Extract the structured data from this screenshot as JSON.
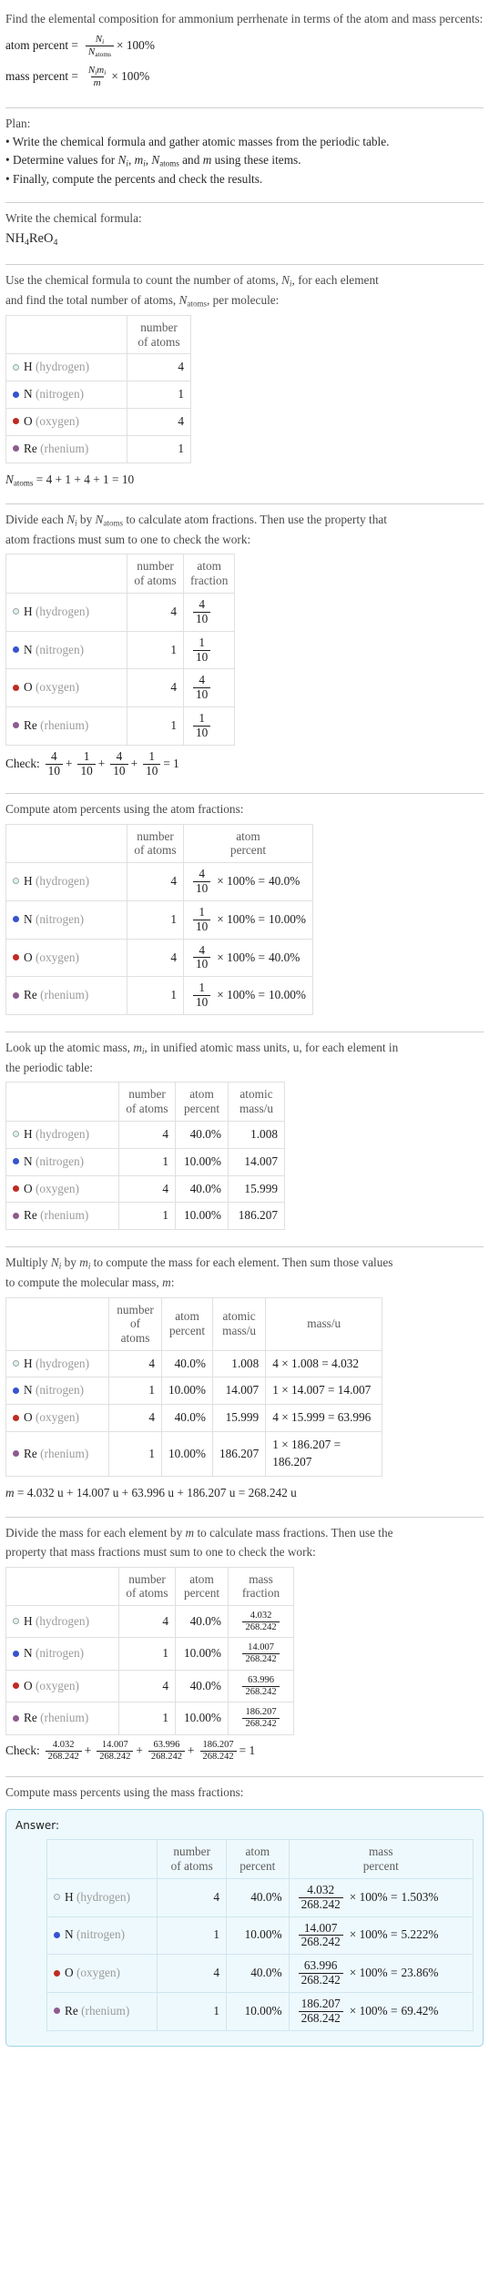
{
  "problem": {
    "statement": "Find the elemental composition for ammonium perrhenate in terms of the atom and mass percents:",
    "formula_atom_percent_label": "atom percent =",
    "formula_mass_percent_label": "mass percent =",
    "atom_percent_num": "N",
    "atom_percent_num_sub": "i",
    "atom_percent_den": "N",
    "atom_percent_den_sub": "atoms",
    "mass_percent_num": "N",
    "mass_percent_num_sub": "i",
    "mass_percent_num2": "m",
    "mass_percent_num2_sub": "i",
    "mass_percent_den": "m",
    "times_100": "× 100%"
  },
  "plan": {
    "heading": "Plan:",
    "bullets": [
      "• Write the chemical formula and gather atomic masses from the periodic table.",
      "• Determine values for Ni, mi, Natoms and m using these items.",
      "• Finally, compute the percents and check the results."
    ]
  },
  "chemical_formula": {
    "prompt": "Write the chemical formula:",
    "formula": "NH4ReO4",
    "formula_parts": [
      {
        "t": "NH",
        "sub": "4"
      },
      {
        "t": "ReO",
        "sub": "4"
      }
    ]
  },
  "count_atoms": {
    "prompt_line1": "Use the chemical formula to count the number of atoms, Ni, for each element",
    "prompt_line2": "and find the total number of atoms, Natoms, per molecule:",
    "headers": [
      "",
      "number of atoms"
    ],
    "total_equation": "Natoms = 4 + 1 + 4 + 1 = 10",
    "total_terms": [
      "4",
      "1",
      "4",
      "1"
    ],
    "total_value": "10"
  },
  "elements": [
    {
      "symbol": "H",
      "name": "(hydrogen)",
      "color": "#ddf2f2",
      "stroke": "#9aa5a5",
      "count": "4",
      "atom_fraction_num": "4",
      "atom_fraction_den": "10",
      "atom_percent": "40.0%",
      "atomic_mass": "1.008",
      "mass_expr_left": "4",
      "mass_expr_value": "4.032",
      "mass_fraction_num": "4.032",
      "mass_fraction_den": "268.242",
      "mass_percent": "1.503%"
    },
    {
      "symbol": "N",
      "name": "(nitrogen)",
      "color": "#3753cf",
      "stroke": "#3753cf",
      "count": "1",
      "atom_fraction_num": "1",
      "atom_fraction_den": "10",
      "atom_percent": "10.00%",
      "atomic_mass": "14.007",
      "mass_expr_left": "1",
      "mass_expr_value": "14.007",
      "mass_fraction_num": "14.007",
      "mass_fraction_den": "268.242",
      "mass_percent": "5.222%"
    },
    {
      "symbol": "O",
      "name": "(oxygen)",
      "color": "#c02b22",
      "stroke": "#c02b22",
      "count": "4",
      "atom_fraction_num": "4",
      "atom_fraction_den": "10",
      "atom_percent": "40.0%",
      "atomic_mass": "15.999",
      "mass_expr_left": "4",
      "mass_expr_value": "63.996",
      "mass_fraction_num": "63.996",
      "mass_fraction_den": "268.242",
      "mass_percent": "23.86%"
    },
    {
      "symbol": "Re",
      "name": "(rhenium)",
      "color": "#8e5c8e",
      "stroke": "#8e5c8e",
      "count": "1",
      "atom_fraction_num": "1",
      "atom_fraction_den": "10",
      "atom_percent": "10.00%",
      "atomic_mass": "186.207",
      "mass_expr_left": "1",
      "mass_expr_value": "186.207",
      "mass_fraction_num": "186.207",
      "mass_fraction_den": "268.242",
      "mass_percent": "69.42%"
    }
  ],
  "atom_fraction_section": {
    "prompt_line1": "Divide each Ni by Natoms to calculate atom fractions. Then use the property that",
    "prompt_line2": "atom fractions must sum to one to check the work:",
    "headers": [
      "",
      "number of atoms",
      "atom fraction"
    ],
    "check_label": "Check:",
    "check_result": "= 1"
  },
  "atom_percent_section": {
    "prompt": "Compute atom percents using the atom fractions:",
    "headers": [
      "",
      "number of atoms",
      "atom percent"
    ],
    "times_100_eq": "× 100% ="
  },
  "atomic_mass_section": {
    "prompt_line1": "Look up the atomic mass, mi, in unified atomic mass units, u, for each element in",
    "prompt_line2": "the periodic table:",
    "headers": [
      "",
      "number of atoms",
      "atom percent",
      "atomic mass/u"
    ]
  },
  "mass_section": {
    "prompt_line1": "Multiply Ni by mi to compute the mass for each element. Then sum those values",
    "prompt_line2": "to compute the molecular mass, m:",
    "headers": [
      "",
      "number of atoms",
      "atom percent",
      "atomic mass/u",
      "mass/u"
    ],
    "times": "×",
    "equals": "=",
    "molecular_mass_equation": "m = 4.032 u + 14.007 u + 63.996 u + 186.207 u = 268.242 u",
    "molecular_mass_terms": [
      "4.032 u",
      "14.007 u",
      "63.996 u",
      "186.207 u"
    ],
    "molecular_mass_total": "268.242 u"
  },
  "mass_fraction_section": {
    "prompt_line1": "Divide the mass for each element by m to calculate mass fractions. Then use the",
    "prompt_line2": "property that mass fractions must sum to one to check the work:",
    "headers": [
      "",
      "number of atoms",
      "atom percent",
      "mass fraction"
    ],
    "check_label": "Check:",
    "check_result": "= 1"
  },
  "mass_percent_section": {
    "prompt": "Compute mass percents using the mass fractions:",
    "answer_label": "Answer:",
    "headers": [
      "",
      "number of atoms",
      "atom percent",
      "mass percent"
    ],
    "times_100_eq": "× 100% ="
  }
}
